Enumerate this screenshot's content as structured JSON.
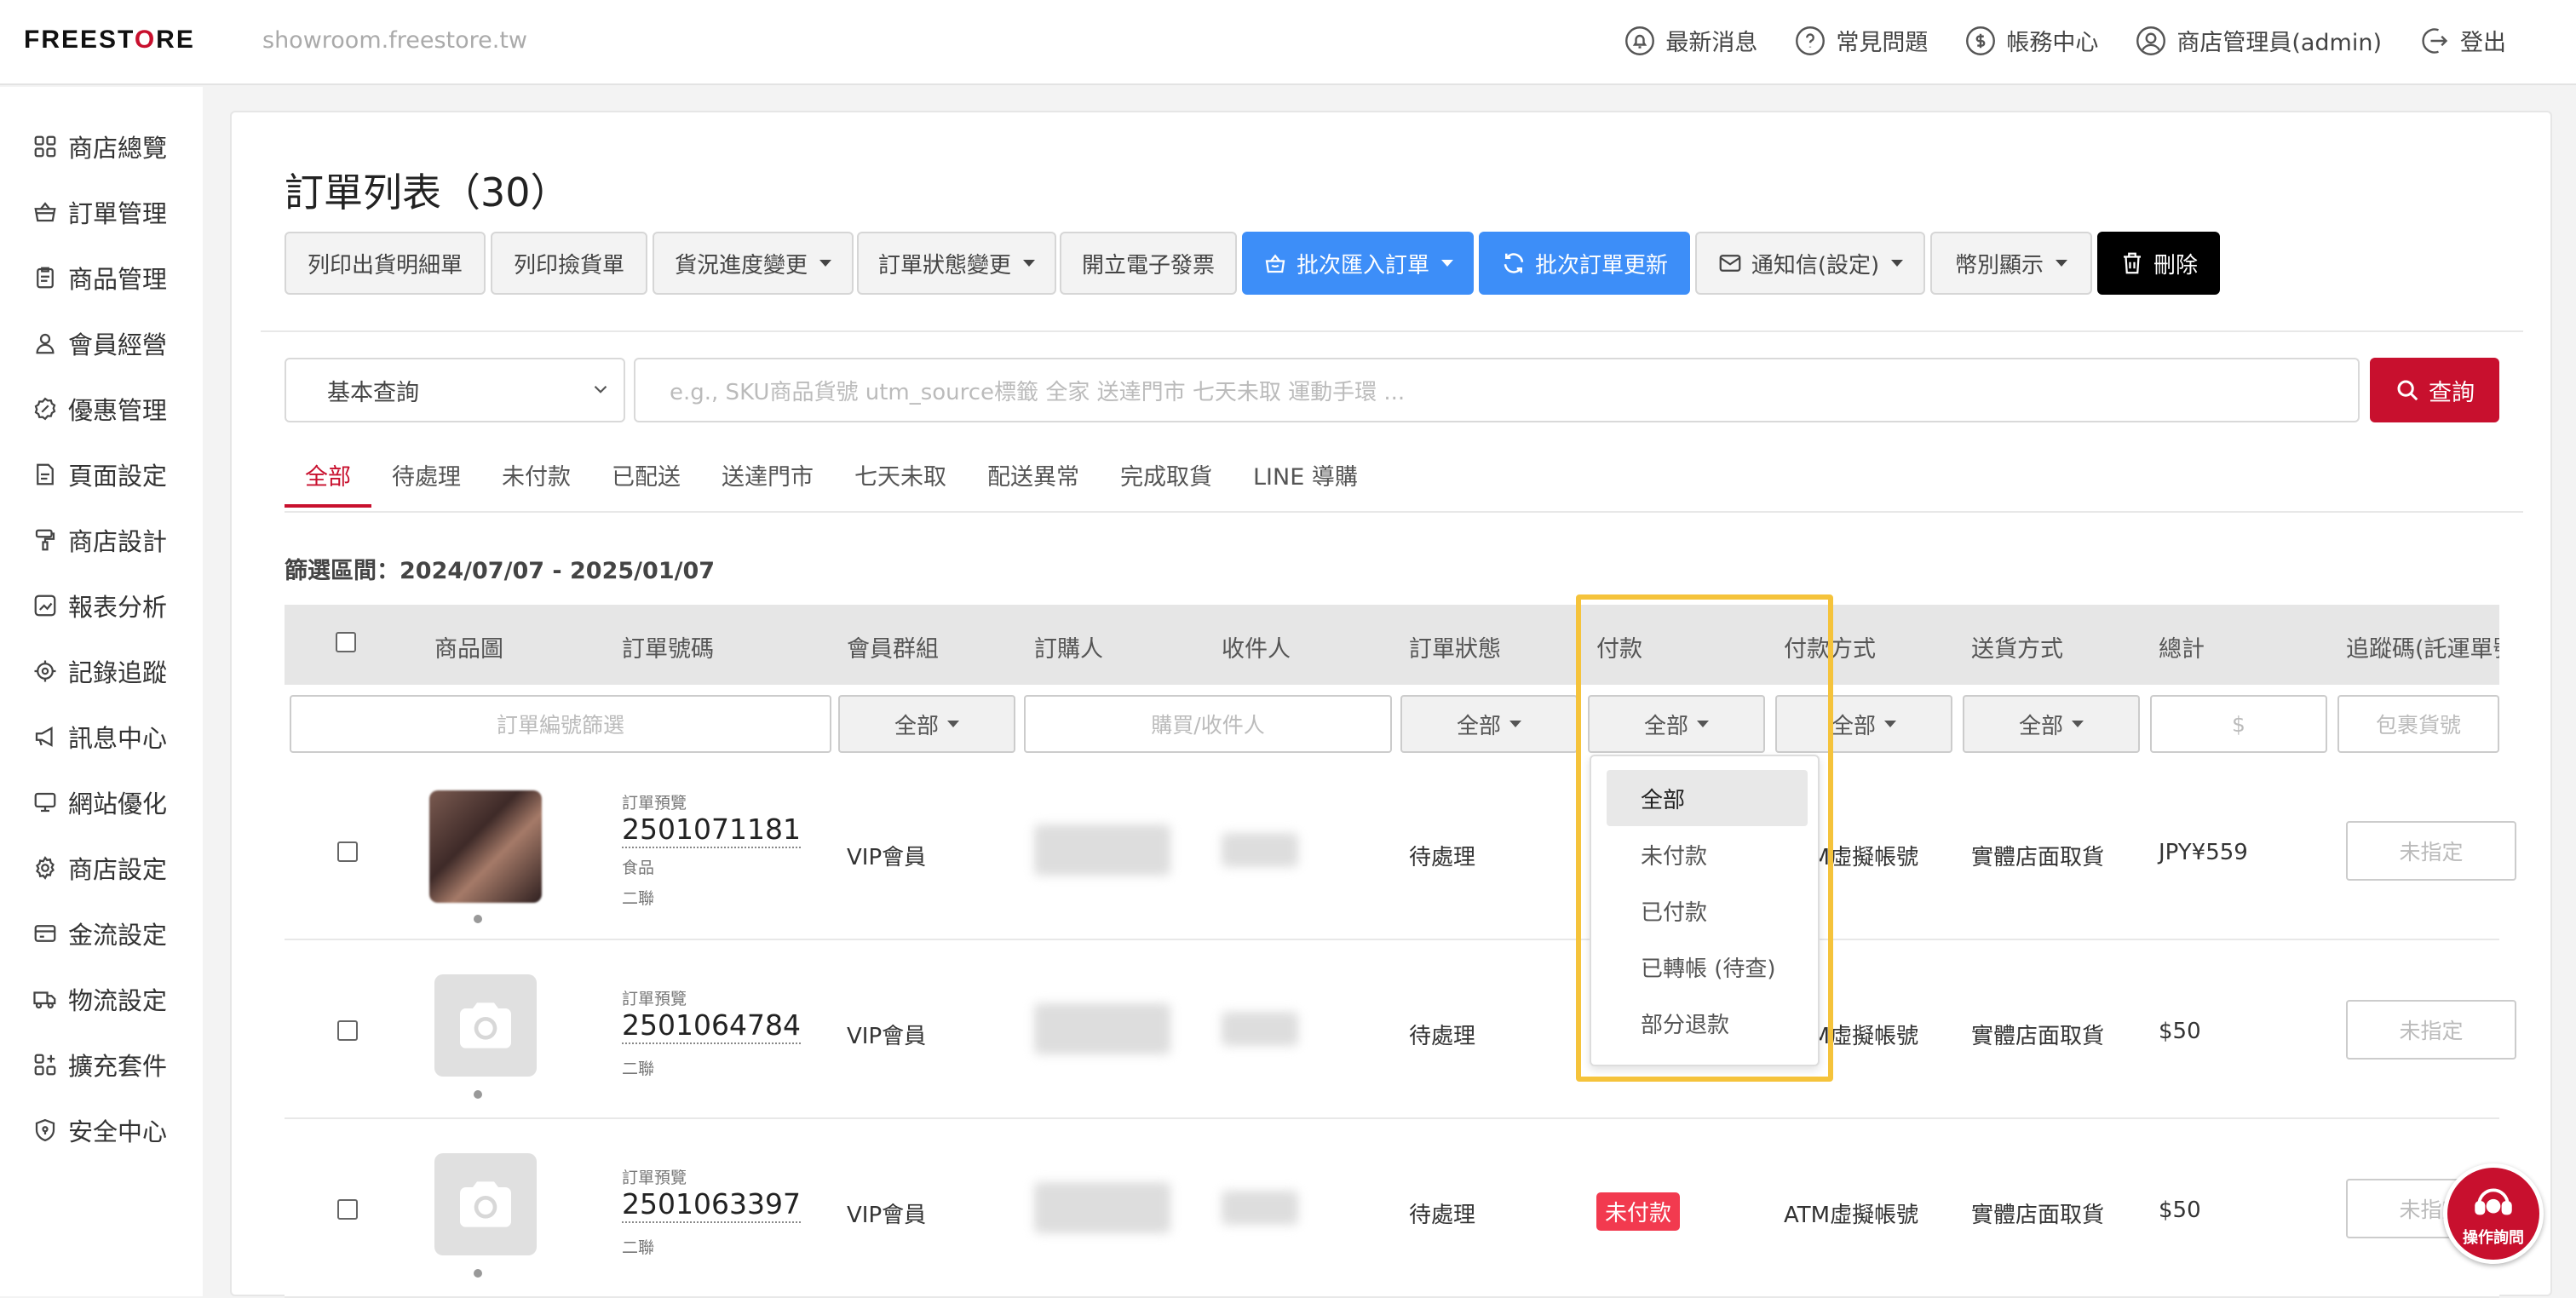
{
  "brand": {
    "logo_a": "FREE",
    "logo_b": "ST",
    "logo_c": "O",
    "logo_d": "RE",
    "host": "showroom.freestore.tw"
  },
  "topnav": [
    {
      "icon": "bell-icon",
      "label": "最新消息"
    },
    {
      "icon": "question-icon",
      "label": "常見問題"
    },
    {
      "icon": "dollar-icon",
      "label": "帳務中心"
    },
    {
      "icon": "user-icon",
      "label": "商店管理員(admin)"
    },
    {
      "icon": "logout-icon",
      "label": "登出"
    }
  ],
  "sidebar": [
    {
      "icon": "grid-icon",
      "label": "商店總覽"
    },
    {
      "icon": "basket-icon",
      "label": "訂單管理"
    },
    {
      "icon": "clipboard-icon",
      "label": "商品管理"
    },
    {
      "icon": "person-icon",
      "label": "會員經營"
    },
    {
      "icon": "discount-icon",
      "label": "優惠管理"
    },
    {
      "icon": "page-icon",
      "label": "頁面設定"
    },
    {
      "icon": "brush-icon",
      "label": "商店設計"
    },
    {
      "icon": "report-icon",
      "label": "報表分析"
    },
    {
      "icon": "target-icon",
      "label": "記錄追蹤"
    },
    {
      "icon": "megaphone-icon",
      "label": "訊息中心"
    },
    {
      "icon": "monitor-icon",
      "label": "網站優化"
    },
    {
      "icon": "gear-icon",
      "label": "商店設定"
    },
    {
      "icon": "card-icon",
      "label": "金流設定"
    },
    {
      "icon": "truck-icon",
      "label": "物流設定"
    },
    {
      "icon": "plugin-icon",
      "label": "擴充套件"
    },
    {
      "icon": "shield-icon",
      "label": "安全中心"
    }
  ],
  "page": {
    "title": "訂單列表（30）"
  },
  "toolbar": [
    {
      "label": "列印出貨明細單",
      "style": "default",
      "caret": false
    },
    {
      "label": "列印撿貨單",
      "style": "default",
      "caret": false
    },
    {
      "label": "貨況進度變更",
      "style": "default",
      "caret": true
    },
    {
      "label": "訂單狀態變更",
      "style": "default",
      "caret": true
    },
    {
      "label": "開立電子發票",
      "style": "default",
      "caret": false
    },
    {
      "label": "批次匯入訂單",
      "style": "blue",
      "caret": true,
      "icon": "import-icon"
    },
    {
      "label": "批次訂單更新",
      "style": "blue",
      "caret": false,
      "icon": "refresh-icon"
    },
    {
      "label": "通知信(設定)",
      "style": "default",
      "caret": true,
      "icon": "mail-icon"
    },
    {
      "label": "幣別顯示",
      "style": "default",
      "caret": true
    },
    {
      "label": "刪除",
      "style": "black",
      "caret": false,
      "icon": "trash-icon"
    }
  ],
  "search": {
    "mode": "基本查詢",
    "placeholder": "e.g.,  SKU商品貨號   utm_source標籤   全家   送達門市   七天未取   運動手環  ...",
    "button": "查詢"
  },
  "tabs": [
    "全部",
    "待處理",
    "未付款",
    "已配送",
    "送達門市",
    "七天未取",
    "配送異常",
    "完成取貨",
    "LINE 導購"
  ],
  "filter_range": "篩選區間：2024/07/07 - 2025/01/07",
  "columns": [
    "商品圖",
    "訂單號碼",
    "會員群組",
    "訂購人",
    "收件人",
    "訂單狀態",
    "付款",
    "付款方式",
    "送貨方式",
    "總計",
    "追蹤碼(託運單號"
  ],
  "filters": {
    "order_no": "訂單編號篩選",
    "group": "全部",
    "buyer": "購買/收件人",
    "status": "全部",
    "payment": "全部",
    "method": "全部",
    "shipping": "全部",
    "total": "$",
    "tracking": "包裹貨號"
  },
  "rows": [
    {
      "preview": "訂單預覽",
      "order_no": "2501071181",
      "tags": [
        "食品",
        "二聯"
      ],
      "group": "VIP會員",
      "status": "待處理",
      "payment": "",
      "method": "ATM虛擬帳號",
      "shipping": "實體店面取貨",
      "total": "JPY¥559",
      "tracking": "未指定",
      "thumb": "photo"
    },
    {
      "preview": "訂單預覽",
      "order_no": "2501064784",
      "tags": [
        "二聯"
      ],
      "group": "VIP會員",
      "status": "待處理",
      "payment": "",
      "method": "ATM虛擬帳號",
      "shipping": "實體店面取貨",
      "total": "$50",
      "tracking": "未指定",
      "thumb": "camera"
    },
    {
      "preview": "訂單預覽",
      "order_no": "2501063397",
      "tags": [
        "二聯"
      ],
      "group": "VIP會員",
      "status": "待處理",
      "payment": "未付款",
      "method": "ATM虛擬帳號",
      "shipping": "實體店面取貨",
      "total": "$50",
      "tracking": "未指定",
      "thumb": "camera"
    }
  ],
  "payment_dropdown": {
    "options": [
      "全部",
      "未付款",
      "已付款",
      "已轉帳 (待查)",
      "部分退款"
    ],
    "selected": "全部"
  },
  "help_button": {
    "label": "操作詢問"
  },
  "colors": {
    "brand_red": "#c8102e",
    "blue": "#3d8ef8",
    "highlight": "#f5c33b",
    "badge_red": "#f23a4f"
  }
}
